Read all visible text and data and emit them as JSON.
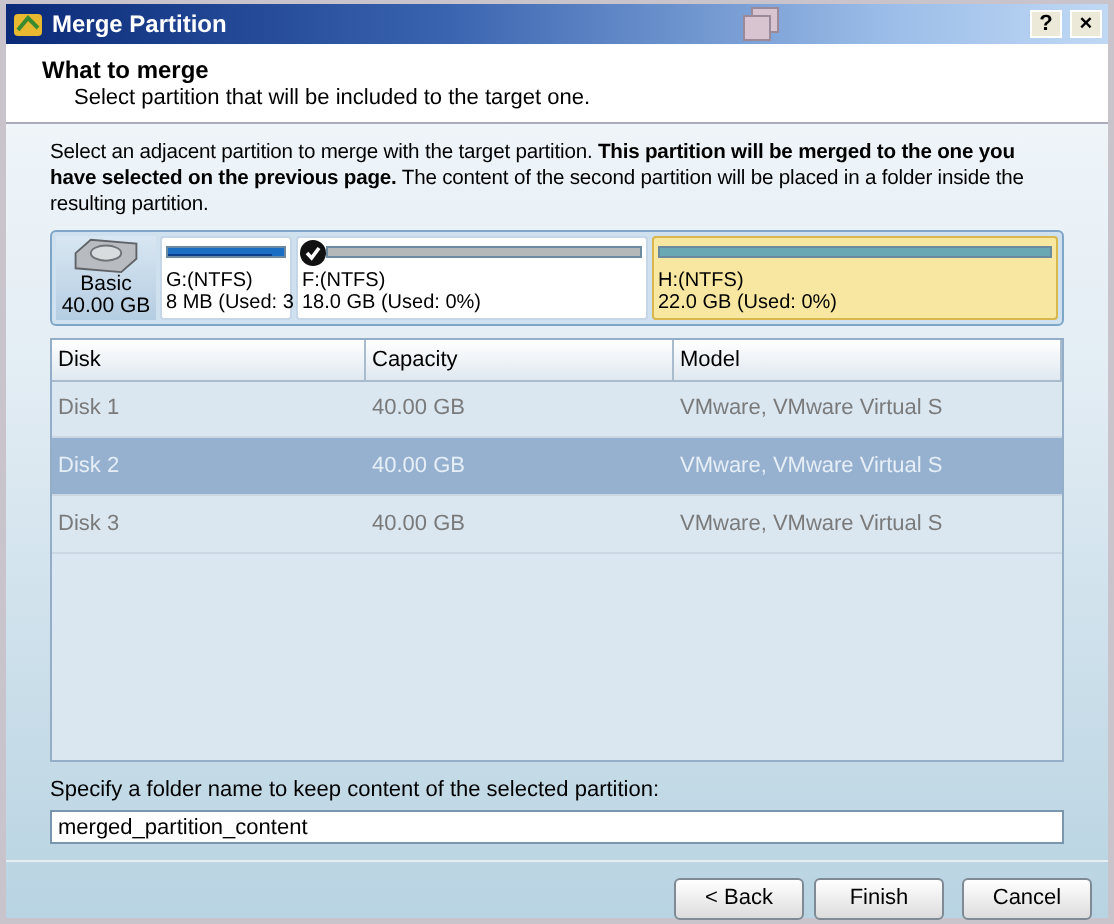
{
  "window": {
    "title": "Merge Partition",
    "buttons": [
      "?",
      "×"
    ]
  },
  "header": {
    "title": "What to merge",
    "subtitle": "Select partition that will be included to the target one."
  },
  "instructions": "Select an adjacent partition to merge with the target partition. **This partition will be merged to the one you have selected on the previous page.** The content of the second partition will be placed in a folder inside the resulting partition.",
  "disk_map": {
    "disk": {
      "type": "Basic",
      "size": "40.00 GB"
    },
    "partitions": [
      {
        "name": "G:(NTFS)",
        "info": "8 MB (Used: 3",
        "color": "#1a6fc4",
        "level": 0.9,
        "checked": false,
        "highlighted": false
      },
      {
        "name": "F:(NTFS)",
        "info": "18.0 GB (Used: 0%)",
        "color": "#b4b8b8",
        "checked": true,
        "highlighted": false
      },
      {
        "name": "H:(NTFS)",
        "info": "22.0 GB (Used: 0%)",
        "color": "#6aa9b4",
        "checked": false,
        "highlighted": true
      }
    ]
  },
  "table": {
    "columns": [
      "Disk",
      "Capacity",
      "Model"
    ],
    "rows": [
      {
        "cells": [
          "Disk 1",
          "40.00 GB",
          "VMware, VMware Virtual S"
        ],
        "selected": false
      },
      {
        "cells": [
          "Disk 2",
          "40.00 GB",
          "VMware, VMware Virtual S"
        ],
        "selected": true
      },
      {
        "cells": [
          "Disk 3",
          "40.00 GB",
          "VMware, VMware Virtual S"
        ],
        "selected": false
      }
    ]
  },
  "folder": {
    "label": "Specify a folder name to keep content of the selected partition:",
    "value": "merged_partition_content"
  },
  "buttons": [
    "< Back",
    "Finish",
    "Cancel"
  ]
}
